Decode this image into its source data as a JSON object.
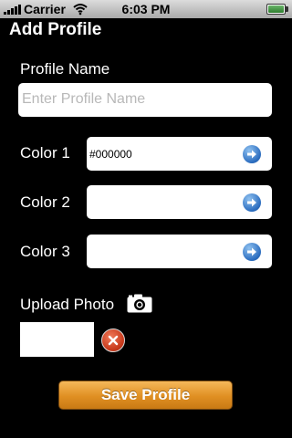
{
  "status_bar": {
    "carrier": "Carrier",
    "time": "6:03 PM"
  },
  "header": {
    "title": "Add Profile"
  },
  "form": {
    "profile_name_label": "Profile Name",
    "profile_name_placeholder": "Enter Profile Name",
    "color1_label": "Color 1",
    "color1_value": "#000000",
    "color2_label": "Color 2",
    "color2_value": "",
    "color3_label": "Color 3",
    "color3_value": "",
    "upload_photo_label": "Upload Photo",
    "save_label": "Save Profile"
  },
  "colors": {
    "background": "#000000",
    "save_button": "#e08f22",
    "arrow_button": "#2a6cbf",
    "delete_button": "#c83a1c"
  },
  "icons": {
    "arrow": "arrow-right-circle-icon",
    "camera": "camera-icon",
    "delete": "close-circle-icon"
  }
}
